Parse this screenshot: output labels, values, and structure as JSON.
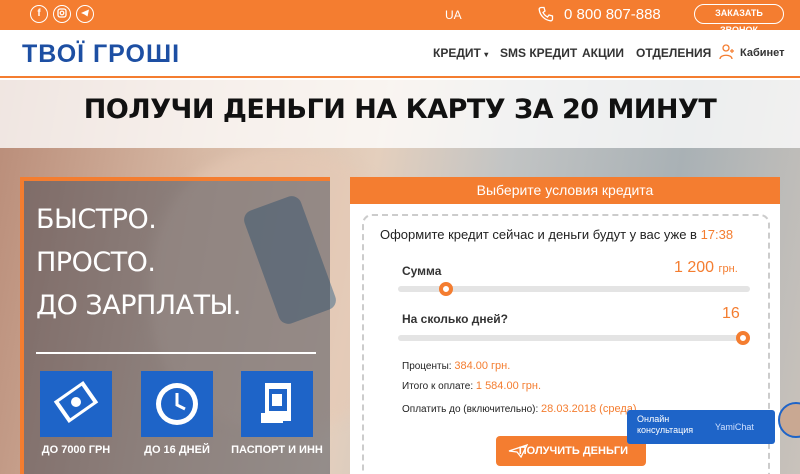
{
  "topbar": {
    "social": [
      "facebook-icon",
      "instagram-icon",
      "telegram-icon"
    ],
    "lang": "UA",
    "phone": "0 800 807-888",
    "callback_label": "ЗАКАЗАТЬ ЗВОНОК"
  },
  "nav": {
    "logo": "ТВОЇ ГРОШІ",
    "menu": [
      "КРЕДИТ",
      "SMS КРЕДИТ",
      "АКЦИИ",
      "ОТДЕЛЕНИЯ"
    ],
    "cabinet": "Кабинет"
  },
  "hero": {
    "title": "ПОЛУЧИ ДЕНЬГИ НА КАРТУ ЗА 20 МИНУТ",
    "tagline": [
      "БЫСТРО.",
      "ПРОСТО.",
      "ДО ЗАРПЛАТЫ."
    ],
    "features": [
      {
        "icon": "money-icon",
        "label": "ДО 7000 ГРН"
      },
      {
        "icon": "clock-icon",
        "label": "ДО 16 ДНЕЙ"
      },
      {
        "icon": "passport-icon",
        "label": "ПАСПОРТ И ИНН"
      }
    ]
  },
  "calc": {
    "header": "Выберите условия кредита",
    "intro": "Оформите кредит сейчас и деньги будут у вас уже в",
    "intro_time": "17:38",
    "amount_label": "Сумма",
    "amount_value": "1 200",
    "amount_unit": "грн.",
    "amount_fraction": 0.12,
    "days_label": "На сколько дней?",
    "days_value": "16",
    "days_fraction": 1.0,
    "interest_label": "Проценты:",
    "interest_value": "384.00 грн.",
    "total_label": "Итого к оплате:",
    "total_value": "1 584.00 грн.",
    "due_label": "Оплатить до (включительно):",
    "due_value": "28.03.2018 (среда)",
    "submit": "ПОЛУЧИТЬ ДЕНЬГИ"
  },
  "chat": {
    "text": "Онлайн консультация",
    "brand": "YamiChat"
  },
  "colors": {
    "accent": "#f47d30",
    "brand_blue": "#1d4fa3",
    "feature_blue": "#1e64c8"
  }
}
